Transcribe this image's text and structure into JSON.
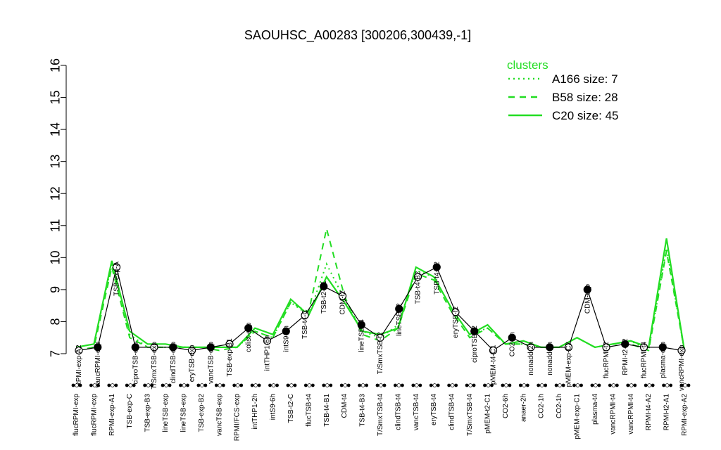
{
  "chart_data": {
    "type": "line",
    "title": "SAOUHSC_A00283 [300206,300439,-1]",
    "xlabel": "",
    "ylabel": "",
    "ylim": [
      7,
      16
    ],
    "yticks": [
      7,
      8,
      9,
      10,
      11,
      12,
      13,
      14,
      15,
      16
    ],
    "grid": false,
    "legend": {
      "title": "clusters",
      "position": "top-right",
      "entries": [
        {
          "label": "A166 size: 7",
          "style": "dotted"
        },
        {
          "label": "B58 size: 28",
          "style": "dashed"
        },
        {
          "label": "C20 size: 45",
          "style": "solid"
        }
      ]
    },
    "colors": {
      "cluster_lines": "#22dd22",
      "profile": "#000000",
      "open_point": "#ffffff",
      "filled_point": "#000000"
    },
    "categories": [
      "flucRPMI-exp",
      "flucRPMI-exp",
      "RPMI-exp-A1",
      "TSB-exp-C",
      "TSB-exp-B3",
      "lineTSB-exp",
      "lineTSB-exp",
      "TSB-exp-B2",
      "vancTSB-exp",
      "RPMI/FCS-exp",
      "intTHP1-2h",
      "intS9-6h",
      "TSB-t2-C",
      "flucTSB-t4",
      "TSB-t4-B1",
      "CDM-t4",
      "TSB-t4-B3",
      "T/SmxTSB-t4",
      "clindTSB-t4",
      "vancTSB-t4",
      "eryTSB-t4",
      "clindTSB-t4",
      "T/SmxTSB-t4",
      "pMEM-t2-C1",
      "CO2-6h",
      "anaer-2h",
      "CO2-1h",
      "CO2-1h",
      "pMEM-exp-C1",
      "plasma-t4",
      "vancRPMI-t4",
      "vancRPMI-t4",
      "RPMI-t4-A2",
      "RPMI-t2-A1",
      "RPMI-exp-A2"
    ],
    "series": [
      {
        "name": "A166 size: 7",
        "style": "dotted",
        "values": [
          7.2,
          7.3,
          9.8,
          7.6,
          7.2,
          7.2,
          7.2,
          7.2,
          7.2,
          7.2,
          7.7,
          7.5,
          8.6,
          8.2,
          9.8,
          8.7,
          7.7,
          7.5,
          7.9,
          9.6,
          9.4,
          8.4,
          7.6,
          7.8,
          7.3,
          7.3,
          7.2,
          7.2,
          7.5,
          7.2,
          7.3,
          7.4,
          7.1,
          10.3,
          7.1
        ]
      },
      {
        "name": "B58 size: 28",
        "style": "dashed",
        "values": [
          7.1,
          7.2,
          9.7,
          7.5,
          7.2,
          7.2,
          7.2,
          7.2,
          7.1,
          7.2,
          7.7,
          7.5,
          8.6,
          8.3,
          10.9,
          8.8,
          7.6,
          7.4,
          7.8,
          9.5,
          9.3,
          8.3,
          7.5,
          7.8,
          7.3,
          7.3,
          7.2,
          7.2,
          7.5,
          7.2,
          7.3,
          7.3,
          7.1,
          10.2,
          7.1
        ]
      },
      {
        "name": "C20 size: 45",
        "style": "solid",
        "values": [
          7.2,
          7.3,
          9.9,
          7.7,
          7.3,
          7.3,
          7.2,
          7.2,
          7.2,
          7.2,
          7.8,
          7.6,
          8.7,
          8.2,
          9.4,
          8.6,
          7.7,
          7.6,
          7.8,
          9.7,
          9.4,
          8.4,
          7.6,
          7.9,
          7.3,
          7.4,
          7.2,
          7.2,
          7.5,
          7.2,
          7.3,
          7.4,
          7.2,
          10.6,
          7.1
        ]
      }
    ],
    "profile": {
      "labels": [
        "RPMI-exp-A2",
        "vancRPMI-exp",
        "TSB-exp-A",
        "ciproTSB-exp",
        "T/SmxTSB-exp",
        "clindTSB-exp",
        "eryTSB-exp",
        "vancTSB-exp",
        "TSB-exp-B1",
        "colist-exp",
        "intTHP1-6h",
        "intS9-2h",
        "TSB-t4-C",
        "TSB-t2-B1",
        "CDM-t2",
        "lineTSB-t4",
        "T/SmxTSB-t2",
        "lineTSB-t2",
        "TSB-t4-B2",
        "TSB-t4-B2",
        "eryTSB-t2",
        "ciproTSB-t2",
        "pMEM-t4-C1",
        "CO2-2h",
        "nonadd-2h",
        "nonadd-1h",
        "pMEM-exp-C2",
        "CDM-exp",
        "flucRPMI-t2",
        "RPMI-t2-A2",
        "flucRPMI-t4",
        "plasma-exp",
        "vancRPMI-exp"
      ],
      "values": [
        7.1,
        7.2,
        9.7,
        7.2,
        7.2,
        7.2,
        7.1,
        7.2,
        7.3,
        7.8,
        7.4,
        7.7,
        8.2,
        9.1,
        8.8,
        7.9,
        7.5,
        8.4,
        9.4,
        9.7,
        8.3,
        7.7,
        7.1,
        7.5,
        7.2,
        7.2,
        7.2,
        9.0,
        7.2,
        7.3,
        7.2,
        7.2,
        7.1
      ]
    }
  }
}
